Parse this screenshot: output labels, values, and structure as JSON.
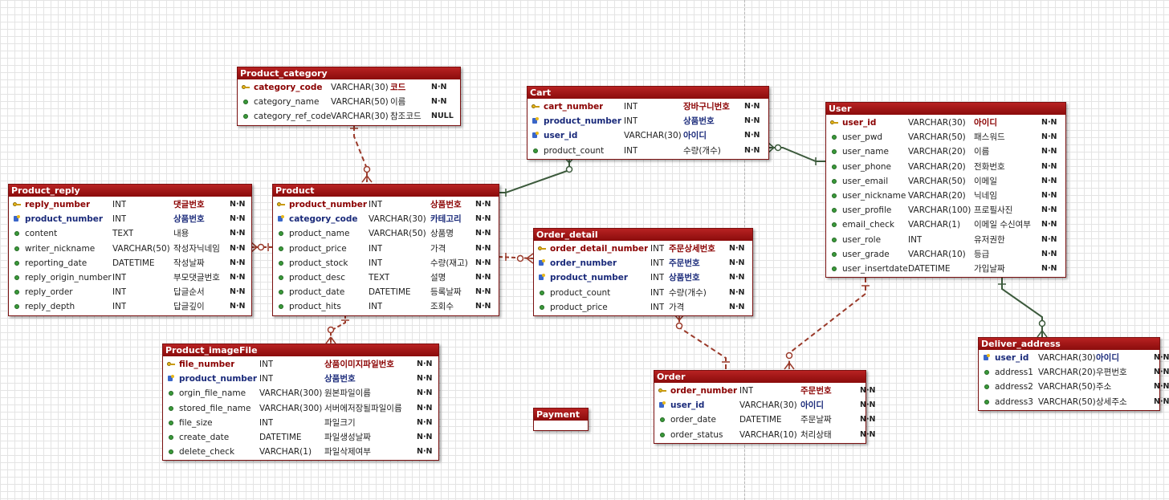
{
  "diagram": {
    "tables": {
      "product_category": {
        "name": "Product_category",
        "columns": [
          {
            "name": "category_code",
            "type": "VARCHAR(30)",
            "comment": "코드",
            "null": "N·N",
            "key": "pk"
          },
          {
            "name": "category_name",
            "type": "VARCHAR(50)",
            "comment": "이름",
            "null": "N·N",
            "key": "none"
          },
          {
            "name": "category_ref_code",
            "type": "VARCHAR(30)",
            "comment": "참조코드",
            "null": "NULL",
            "key": "none"
          }
        ]
      },
      "cart": {
        "name": "Cart",
        "columns": [
          {
            "name": "cart_number",
            "type": "INT",
            "comment": "장바구니번호",
            "null": "N·N",
            "key": "pk"
          },
          {
            "name": "product_number",
            "type": "INT",
            "comment": "상품번호",
            "null": "N·N",
            "key": "pfk"
          },
          {
            "name": "user_id",
            "type": "VARCHAR(30)",
            "comment": "아이디",
            "null": "N·N",
            "key": "pfk"
          },
          {
            "name": "product_count",
            "type": "INT",
            "comment": "수량(개수)",
            "null": "N·N",
            "key": "none"
          }
        ]
      },
      "user": {
        "name": "User",
        "columns": [
          {
            "name": "user_id",
            "type": "VARCHAR(30)",
            "comment": "아이디",
            "null": "N·N",
            "key": "pk"
          },
          {
            "name": "user_pwd",
            "type": "VARCHAR(50)",
            "comment": "패스워드",
            "null": "N·N",
            "key": "none"
          },
          {
            "name": "user_name",
            "type": "VARCHAR(20)",
            "comment": "이름",
            "null": "N·N",
            "key": "none"
          },
          {
            "name": "user_phone",
            "type": "VARCHAR(20)",
            "comment": "전화번호",
            "null": "N·N",
            "key": "none"
          },
          {
            "name": "user_email",
            "type": "VARCHAR(50)",
            "comment": "이메일",
            "null": "N·N",
            "key": "none"
          },
          {
            "name": "user_nickname",
            "type": "VARCHAR(20)",
            "comment": "닉네임",
            "null": "N·N",
            "key": "none"
          },
          {
            "name": "user_profile",
            "type": "VARCHAR(100)",
            "comment": "프로필사진",
            "null": "N·N",
            "key": "none"
          },
          {
            "name": "email_check",
            "type": "VARCHAR(1)",
            "comment": "이메일 수신여부",
            "null": "N·N",
            "key": "none"
          },
          {
            "name": "user_role",
            "type": "INT",
            "comment": "유저권한",
            "null": "N·N",
            "key": "none"
          },
          {
            "name": "user_grade",
            "type": "VARCHAR(10)",
            "comment": "등급",
            "null": "N·N",
            "key": "none"
          },
          {
            "name": "user_insertdate",
            "type": "DATETIME",
            "comment": "가입날짜",
            "null": "N·N",
            "key": "none"
          }
        ]
      },
      "product_reply": {
        "name": "Product_reply",
        "columns": [
          {
            "name": "reply_number",
            "type": "INT",
            "comment": "댓글번호",
            "null": "N·N",
            "key": "pk"
          },
          {
            "name": "product_number",
            "type": "INT",
            "comment": "상품번호",
            "null": "N·N",
            "key": "fk"
          },
          {
            "name": "content",
            "type": "TEXT",
            "comment": "내용",
            "null": "N·N",
            "key": "none"
          },
          {
            "name": "writer_nickname",
            "type": "VARCHAR(50)",
            "comment": "작성자닉네임",
            "null": "N·N",
            "key": "none"
          },
          {
            "name": "reporting_date",
            "type": "DATETIME",
            "comment": "작성날짜",
            "null": "N·N",
            "key": "none"
          },
          {
            "name": "reply_origin_number",
            "type": "INT",
            "comment": "부모댓글번호",
            "null": "N·N",
            "key": "none"
          },
          {
            "name": "reply_order",
            "type": "INT",
            "comment": "답글순서",
            "null": "N·N",
            "key": "none"
          },
          {
            "name": "reply_depth",
            "type": "INT",
            "comment": "답글깊이",
            "null": "N·N",
            "key": "none"
          }
        ]
      },
      "product": {
        "name": "Product",
        "columns": [
          {
            "name": "product_number",
            "type": "INT",
            "comment": "상품번호",
            "null": "N·N",
            "key": "pk"
          },
          {
            "name": "category_code",
            "type": "VARCHAR(30)",
            "comment": "카테고리",
            "null": "N·N",
            "key": "fk"
          },
          {
            "name": "product_name",
            "type": "VARCHAR(50)",
            "comment": "상품명",
            "null": "N·N",
            "key": "none"
          },
          {
            "name": "product_price",
            "type": "INT",
            "comment": "가격",
            "null": "N·N",
            "key": "none"
          },
          {
            "name": "product_stock",
            "type": "INT",
            "comment": "수량(재고)",
            "null": "N·N",
            "key": "none"
          },
          {
            "name": "product_desc",
            "type": "TEXT",
            "comment": "설명",
            "null": "N·N",
            "key": "none"
          },
          {
            "name": "product_date",
            "type": "DATETIME",
            "comment": "등록날짜",
            "null": "N·N",
            "key": "none"
          },
          {
            "name": "product_hits",
            "type": "INT",
            "comment": "조회수",
            "null": "N·N",
            "key": "none"
          }
        ]
      },
      "order_detail": {
        "name": "Order_detail",
        "columns": [
          {
            "name": "order_detail_number",
            "type": "INT",
            "comment": "주문상세번호",
            "null": "N·N",
            "key": "pk"
          },
          {
            "name": "order_number",
            "type": "INT",
            "comment": "주문번호",
            "null": "N·N",
            "key": "fk"
          },
          {
            "name": "product_number",
            "type": "INT",
            "comment": "상품번호",
            "null": "N·N",
            "key": "fk"
          },
          {
            "name": "product_count",
            "type": "INT",
            "comment": "수량(개수)",
            "null": "N·N",
            "key": "none"
          },
          {
            "name": "product_price",
            "type": "INT",
            "comment": "가격",
            "null": "N·N",
            "key": "none"
          }
        ]
      },
      "product_imagefile": {
        "name": "Product_imageFile",
        "columns": [
          {
            "name": "file_number",
            "type": "INT",
            "comment": "상품이미지파일번호",
            "null": "N·N",
            "key": "pk"
          },
          {
            "name": "product_number",
            "type": "INT",
            "comment": "상품번호",
            "null": "N·N",
            "key": "fk"
          },
          {
            "name": "orgin_file_name",
            "type": "VARCHAR(300)",
            "comment": "원본파일이름",
            "null": "N·N",
            "key": "none"
          },
          {
            "name": "stored_file_name",
            "type": "VARCHAR(300)",
            "comment": "서버에저장될파일이름",
            "null": "N·N",
            "key": "none"
          },
          {
            "name": "file_size",
            "type": "INT",
            "comment": "파일크기",
            "null": "N·N",
            "key": "none"
          },
          {
            "name": "create_date",
            "type": "DATETIME",
            "comment": "파일생성날짜",
            "null": "N·N",
            "key": "none"
          },
          {
            "name": "delete_check",
            "type": "VARCHAR(1)",
            "comment": "파일삭제여부",
            "null": "N·N",
            "key": "none"
          }
        ]
      },
      "payment": {
        "name": "Payment",
        "columns": []
      },
      "order": {
        "name": "Order",
        "columns": [
          {
            "name": "order_number",
            "type": "INT",
            "comment": "주문번호",
            "null": "N·N",
            "key": "pk"
          },
          {
            "name": "user_id",
            "type": "VARCHAR(30)",
            "comment": "아이디",
            "null": "N·N",
            "key": "fk"
          },
          {
            "name": "order_date",
            "type": "DATETIME",
            "comment": "주문날짜",
            "null": "N·N",
            "key": "none"
          },
          {
            "name": "order_status",
            "type": "VARCHAR(10)",
            "comment": "처리상태",
            "null": "N·N",
            "key": "none"
          }
        ]
      },
      "deliver_address": {
        "name": "Deliver_address",
        "columns": [
          {
            "name": "user_id",
            "type": "VARCHAR(30)",
            "comment": "아이디",
            "null": "N·N",
            "key": "pfk"
          },
          {
            "name": "address1",
            "type": "VARCHAR(20)",
            "comment": "우편번호",
            "null": "N·N",
            "key": "none"
          },
          {
            "name": "address2",
            "type": "VARCHAR(50)",
            "comment": "주소",
            "null": "N·N",
            "key": "none"
          },
          {
            "name": "address3",
            "type": "VARCHAR(50)",
            "comment": "상세주소",
            "null": "N·N",
            "key": "none"
          }
        ]
      }
    },
    "colors": {
      "header": "#9a1414",
      "identifying_link": "#3c5a3c",
      "non_identifying_link": "#9a3a2a",
      "pk_text": "#8a0000",
      "fk_text": "#1a2a7a"
    }
  }
}
